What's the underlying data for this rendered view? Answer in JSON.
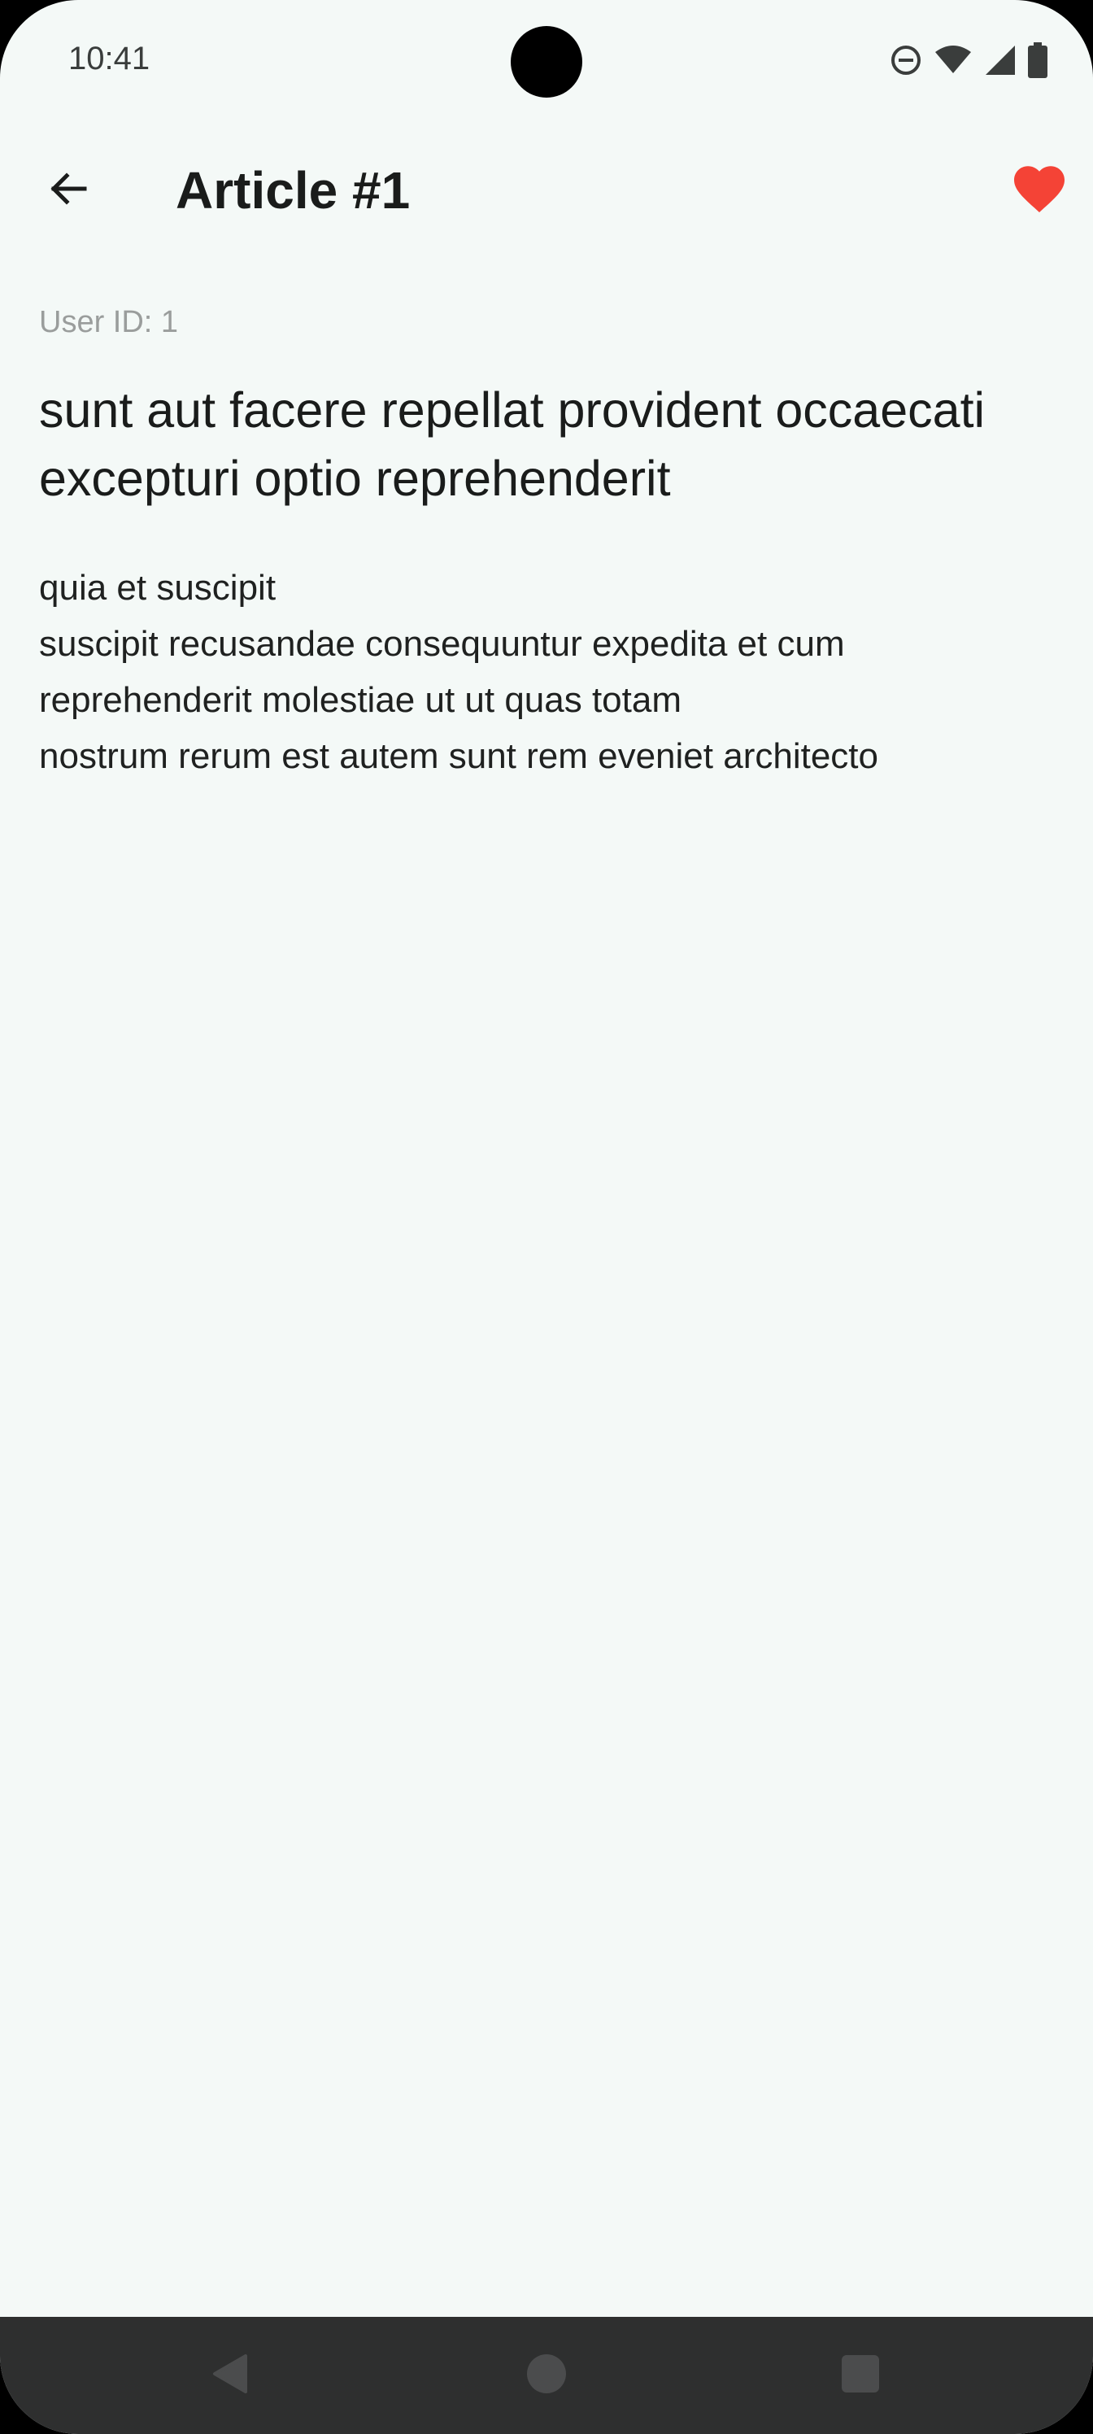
{
  "status_bar": {
    "time": "10:41",
    "icons": [
      "do-not-disturb-icon",
      "wifi-icon",
      "signal-icon",
      "battery-icon"
    ]
  },
  "app_bar": {
    "title": "Article #1",
    "back_icon": "arrow-left-icon",
    "favorite_icon": "heart-icon",
    "favorite_active": true,
    "favorite_color": "#f44336"
  },
  "post": {
    "user_id_label": "User ID: 1",
    "title": "sunt aut facere repellat provident occaecati excepturi optio reprehenderit",
    "body": "quia et suscipit\nsuscipit recusandae consequuntur expedita et cum\nreprehenderit molestiae ut ut quas totam\nnostrum rerum est autem sunt rem eveniet architecto"
  },
  "nav_bar": {
    "buttons": [
      "back-triangle-icon",
      "home-circle-icon",
      "recents-square-icon"
    ]
  },
  "colors": {
    "background": "#f4f9f7",
    "text_primary": "#1a1c1b",
    "text_muted": "#9a9d9c",
    "nav_bar": "#2e2f2f"
  }
}
